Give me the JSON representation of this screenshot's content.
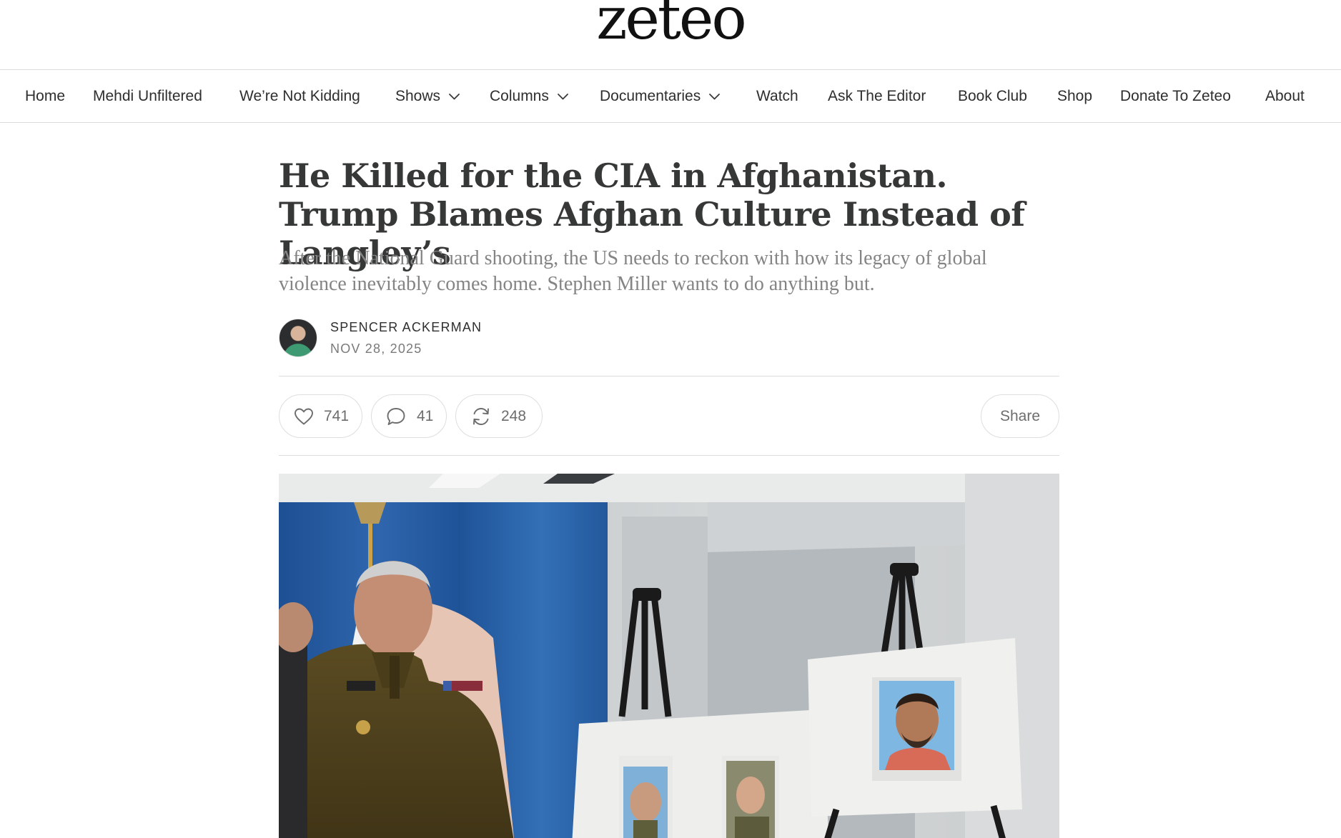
{
  "site": {
    "logo": "zeteo"
  },
  "nav": {
    "items": [
      {
        "label": "Home",
        "dropdown": false
      },
      {
        "label": "Mehdi Unfiltered",
        "dropdown": false
      },
      {
        "label": "We’re Not Kidding",
        "dropdown": false
      },
      {
        "label": "Shows",
        "dropdown": true
      },
      {
        "label": "Columns",
        "dropdown": true
      },
      {
        "label": "Documentaries",
        "dropdown": true
      },
      {
        "label": "Watch",
        "dropdown": false
      },
      {
        "label": "Ask The Editor",
        "dropdown": false
      },
      {
        "label": "Book Club",
        "dropdown": false
      },
      {
        "label": "Shop",
        "dropdown": false
      },
      {
        "label": "Donate To Zeteo",
        "dropdown": false
      },
      {
        "label": "About",
        "dropdown": false
      }
    ]
  },
  "article": {
    "title": "He Killed for the CIA in Afghanistan. Trump Blames Afghan Culture Instead of Langley’s",
    "subtitle": "After the National Guard shooting, the US needs to reckon with how its legacy of global violence inevitably comes home. Stephen Miller wants to do anything but.",
    "author": "SPENCER ACKERMAN",
    "date": "NOV 28, 2025"
  },
  "actions": {
    "likes": "741",
    "comments": "41",
    "restacks": "248",
    "share_label": "Share"
  },
  "icons": {
    "like": "heart-icon",
    "comment": "comment-bubble-icon",
    "restack": "restack-icon",
    "dropdown": "chevron-down-icon"
  }
}
